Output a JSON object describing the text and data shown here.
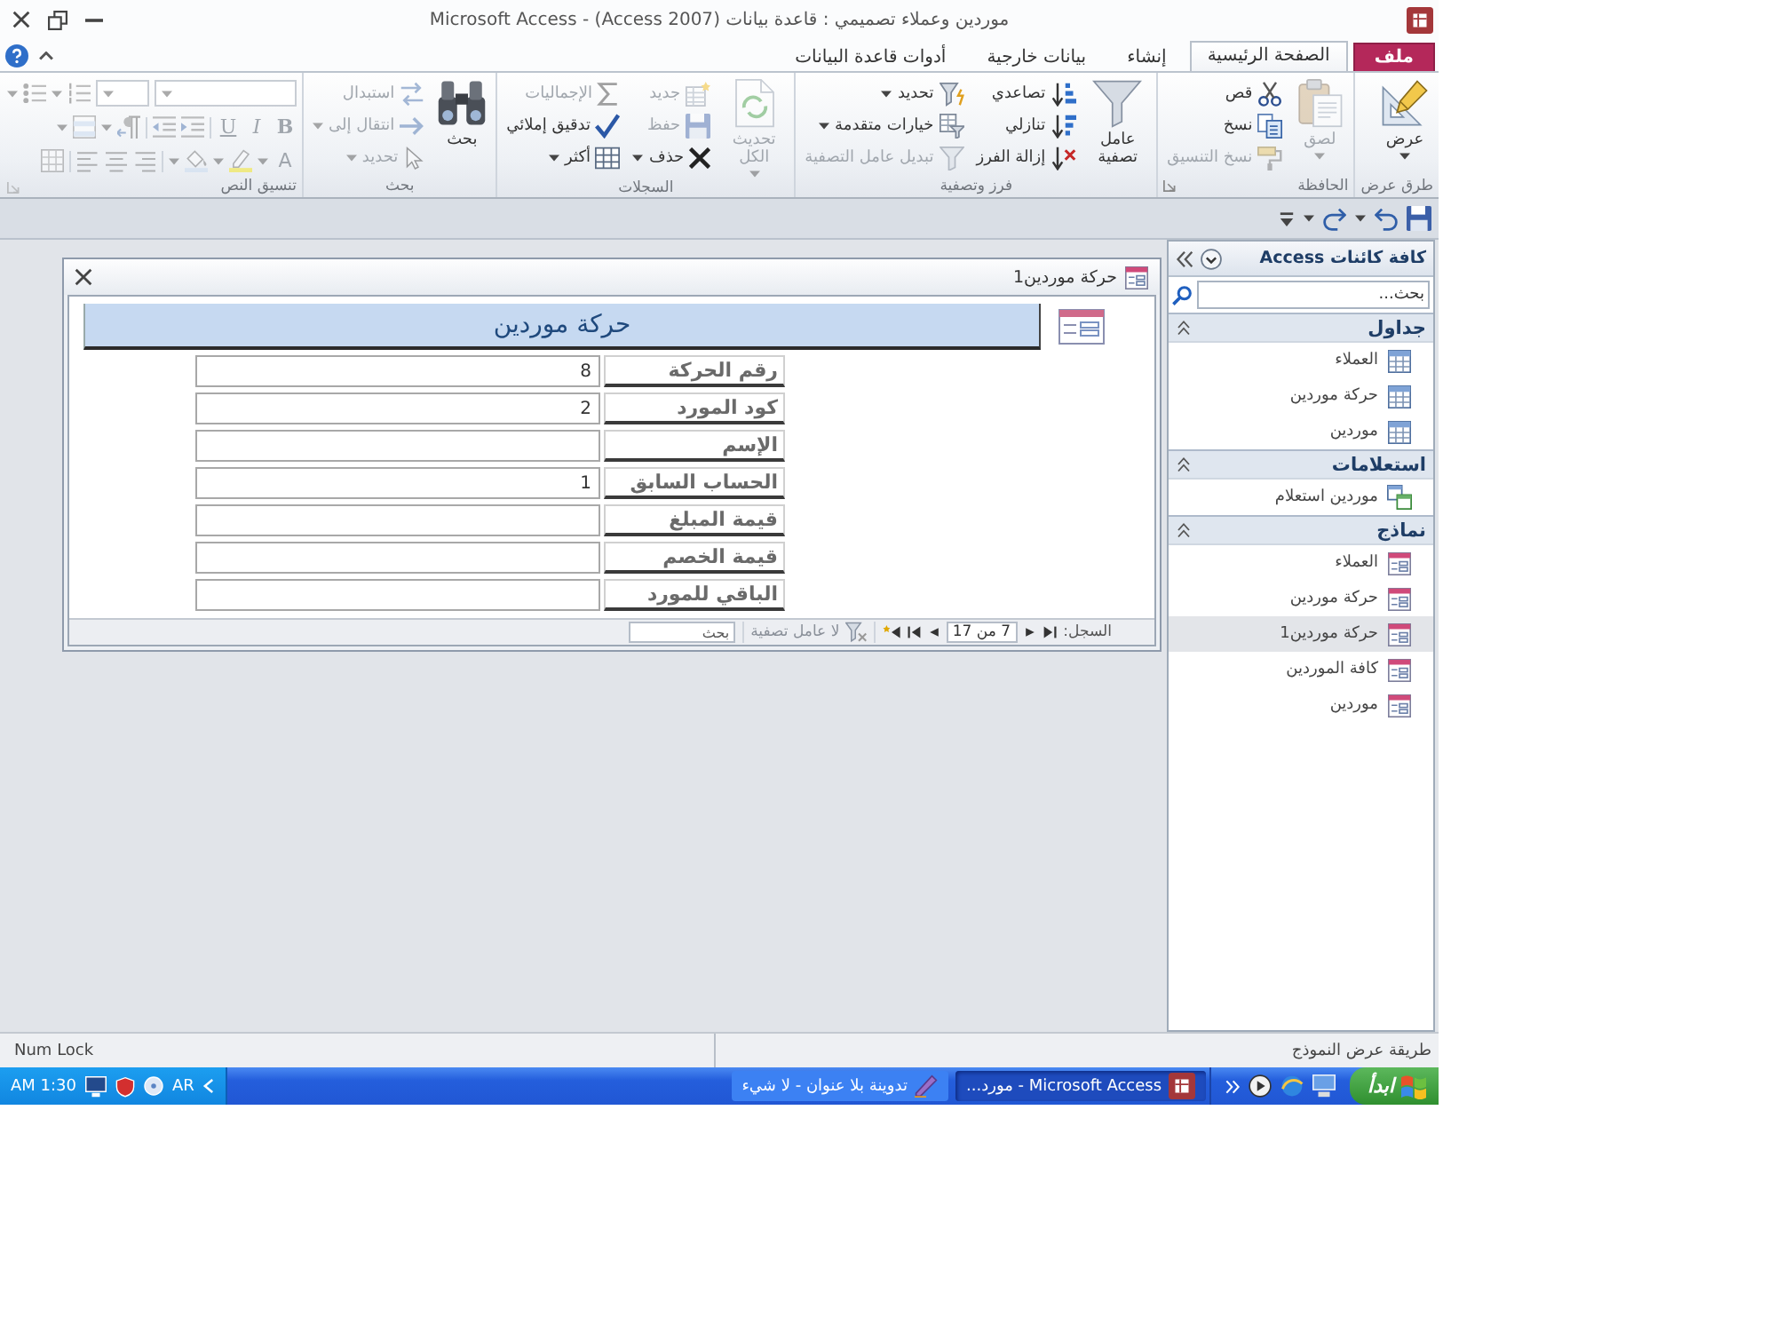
{
  "window": {
    "title": "موردين وعملاء تصميمي : قاعدة بيانات (Access 2007) - Microsoft Access"
  },
  "ribbon_tabs": [
    {
      "label": "ملف",
      "kind": "file",
      "selected": false
    },
    {
      "label": "الصفحة الرئيسية",
      "kind": "tab",
      "selected": true
    },
    {
      "label": "إنشاء",
      "kind": "tab",
      "selected": false
    },
    {
      "label": "بيانات خارجية",
      "kind": "tab",
      "selected": false
    },
    {
      "label": "أدوات قاعدة البيانات",
      "kind": "tab",
      "selected": false
    }
  ],
  "ribbon_groups": [
    {
      "label": "طرق عرض",
      "launcher": false,
      "large": [
        {
          "label": "عرض",
          "dropdown": true,
          "disabled": false
        }
      ]
    },
    {
      "label": "الحافظة",
      "launcher": true,
      "large": [
        {
          "label": "لصق",
          "dropdown": true,
          "disabled": true
        }
      ],
      "columns": [
        [
          {
            "label": "قص",
            "disabled": false
          },
          {
            "label": "نسخ",
            "disabled": false
          },
          {
            "label": "نسخ التنسيق",
            "disabled": true
          }
        ]
      ]
    },
    {
      "label": "فرز وتصفية",
      "launcher": false,
      "large": [
        {
          "label": "عامل تصفية",
          "disabled": false
        }
      ],
      "columns": [
        [
          {
            "label": "تصاعدي",
            "disabled": false
          },
          {
            "label": "تنازلي",
            "disabled": false
          },
          {
            "label": "إزالة الفرز",
            "disabled": false
          }
        ],
        [
          {
            "label": "تحديد",
            "dropdown": true,
            "disabled": false
          },
          {
            "label": "خيارات متقدمة",
            "dropdown": true,
            "disabled": false
          },
          {
            "label": "تبديل عامل التصفية",
            "disabled": true
          }
        ]
      ]
    },
    {
      "label": "السجلات",
      "launcher": false,
      "large": [
        {
          "label": "تحديث الكل",
          "dropdown": true,
          "disabled": true
        }
      ],
      "columns": [
        [
          {
            "label": "جديد",
            "disabled": true
          },
          {
            "label": "حفظ",
            "disabled": true
          },
          {
            "label": "حذف",
            "dropdown": true,
            "disabled": false
          }
        ],
        [
          {
            "label": "الإجماليات",
            "disabled": true
          },
          {
            "label": "تدقيق إملائي",
            "disabled": false
          },
          {
            "label": "أكثر",
            "dropdown": true,
            "disabled": false
          }
        ]
      ]
    },
    {
      "label": "بحث",
      "launcher": false,
      "large": [
        {
          "label": "بحث",
          "disabled": false
        }
      ],
      "columns": [
        [
          {
            "label": "استبدال",
            "disabled": true
          },
          {
            "label": "انتقال إلى",
            "dropdown": true,
            "disabled": true
          },
          {
            "label": "تحديد",
            "dropdown": true,
            "disabled": true
          }
        ]
      ]
    }
  ],
  "text_formatting": {
    "label": "تنسيق النص",
    "launcher": true,
    "disabled": true,
    "letters": [
      {
        "text": "B",
        "kind": "bold"
      },
      {
        "text": "I",
        "kind": "italic"
      },
      {
        "text": "U",
        "kind": "underline"
      }
    ],
    "font_color_letter": "A"
  },
  "navigation": {
    "title": "كافة كائنات Access",
    "search": {
      "placeholder": "بحث..."
    },
    "groups": [
      {
        "label": "جداول",
        "kind": "table",
        "expanded": true,
        "items": [
          {
            "label": "العملاء",
            "selected": false
          },
          {
            "label": "حركة موردين",
            "selected": false
          },
          {
            "label": "موردين",
            "selected": false
          }
        ]
      },
      {
        "label": "استعلامات",
        "kind": "query",
        "expanded": true,
        "items": [
          {
            "label": "موردين استعلام",
            "selected": false
          }
        ]
      },
      {
        "label": "نماذج",
        "kind": "form",
        "expanded": true,
        "items": [
          {
            "label": "العملاء",
            "selected": false
          },
          {
            "label": "حركة موردين",
            "selected": false
          },
          {
            "label": "حركة موردين1",
            "selected": true
          },
          {
            "label": "كافة الموردين",
            "selected": false
          },
          {
            "label": "موردين",
            "selected": false
          }
        ]
      }
    ]
  },
  "form": {
    "title": "حركة موردين1",
    "header": "حركة موردين",
    "fields": [
      {
        "label": "رقم الحركة",
        "value": "8"
      },
      {
        "label": "كود المورد",
        "value": "2"
      },
      {
        "label": "الإسم"
      },
      {
        "label": "الحساب السابق",
        "value": "1"
      },
      {
        "label": "قيمة المبلغ"
      },
      {
        "label": "قيمة الخصم"
      },
      {
        "label": "الباقي للمورد"
      }
    ],
    "record_navigator": {
      "label": "السجل:",
      "position": "7 من 17",
      "filter": "لا عامل تصفية",
      "search": {
        "placeholder": "بحث"
      }
    }
  },
  "status_bar": {
    "view": "طريقة عرض النموذج",
    "indicator": "Num Lock"
  },
  "taskbar": {
    "start": "ابدأ",
    "tasks": [
      {
        "label": "Microsoft Access - مورد...",
        "selected": true
      },
      {
        "label": "تدوينة بلا عنوان - لا شيء",
        "selected": false
      }
    ],
    "language": "AR",
    "clock": "AM 1:30"
  }
}
